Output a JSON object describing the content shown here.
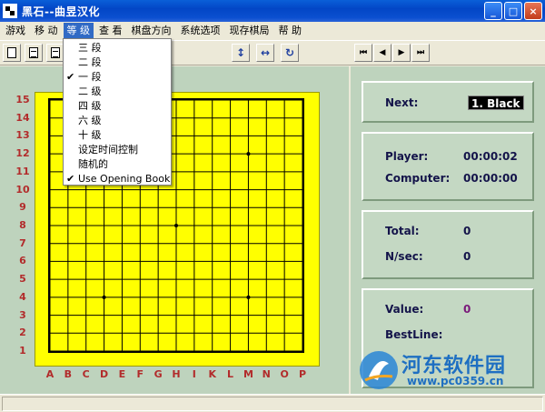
{
  "window": {
    "title": "黑石--曲昱汉化",
    "buttons": {
      "minimize": "_",
      "maximize": "□",
      "close": "×"
    }
  },
  "menu": {
    "items": [
      "游戏",
      "移 动",
      "等 级",
      "查 看",
      "棋盘方向",
      "系统选项",
      "现存棋局",
      "帮 助"
    ],
    "active_index": 2
  },
  "level_menu": {
    "items": [
      {
        "label": "三 段",
        "checked": false
      },
      {
        "label": "二 段",
        "checked": false
      },
      {
        "label": "一 段",
        "checked": true
      },
      {
        "label": "二 级",
        "checked": false
      },
      {
        "label": "四 级",
        "checked": false
      },
      {
        "label": "六 级",
        "checked": false
      },
      {
        "label": "十 级",
        "checked": false
      },
      {
        "label": "设定时间控制",
        "checked": false
      },
      {
        "label": "随机的",
        "checked": false
      },
      {
        "label": "Use Opening Book",
        "checked": true
      }
    ],
    "check_glyph": "✔"
  },
  "toolbar": {
    "icons": [
      "new-document-icon",
      "open-document-icon",
      "save-document-icon",
      "flip-vertical-icon",
      "flip-horizontal-icon",
      "rotate-icon",
      "first-move-icon",
      "previous-move-icon",
      "next-move-icon",
      "last-move-icon"
    ],
    "glyphs": {
      "flip_vertical": "↕",
      "flip_horizontal": "↔",
      "rotate": "↻",
      "first": "⏮",
      "prev": "◀",
      "next": "▶",
      "last": "⏭"
    }
  },
  "board": {
    "size": 15,
    "rank_labels": [
      "15",
      "14",
      "13",
      "12",
      "11",
      "10",
      "9",
      "8",
      "7",
      "6",
      "5",
      "4",
      "3",
      "2",
      "1"
    ],
    "file_labels": [
      "A",
      "B",
      "C",
      "D",
      "E",
      "F",
      "G",
      "H",
      "I",
      "K",
      "L",
      "M",
      "N",
      "O",
      "P"
    ],
    "board_color": "#ffff00",
    "label_color": "#b22b2b",
    "star_points": [
      [
        4,
        4
      ],
      [
        12,
        4
      ],
      [
        8,
        8
      ],
      [
        4,
        12
      ],
      [
        12,
        12
      ]
    ]
  },
  "info": {
    "next_label": "Next:",
    "next_value": "1. Black",
    "player_label": "Player:",
    "player_time": "00:00:02",
    "computer_label": "Computer:",
    "computer_time": "00:00:00",
    "total_label": "Total:",
    "total_value": "0",
    "nsec_label": "N/sec:",
    "nsec_value": "0",
    "value_label": "Value:",
    "value_value": "0",
    "bestline_label": "BestLine:"
  },
  "watermark": {
    "title": "河东软件园",
    "url": "www.pc0359.cn",
    "color": "#1e6fc2"
  }
}
